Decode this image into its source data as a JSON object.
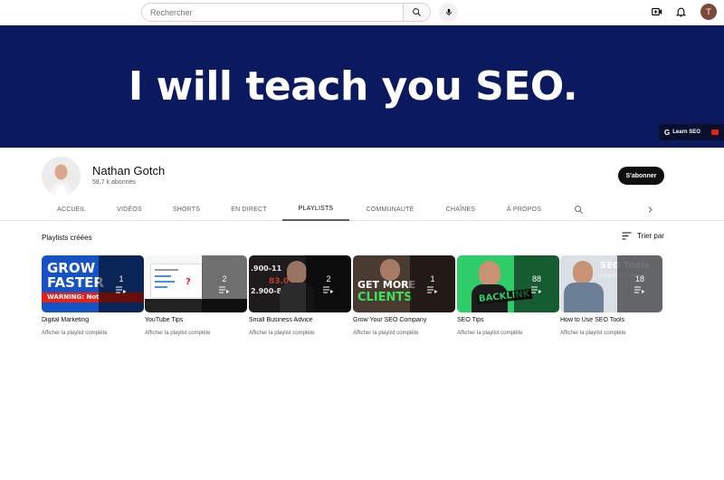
{
  "search": {
    "placeholder": "Rechercher"
  },
  "user": {
    "initial": "T"
  },
  "banner": {
    "headline": "I will teach you SEO.",
    "badge_label": "Learn SEO",
    "badge_logo": "G"
  },
  "channel": {
    "name": "Nathan Gotch",
    "subscribers": "58,7 k abonnés",
    "subscribe_label": "S'abonner"
  },
  "tabs": [
    {
      "label": "ACCUEIL"
    },
    {
      "label": "VIDÉOS"
    },
    {
      "label": "SHORTS"
    },
    {
      "label": "EN DIRECT"
    },
    {
      "label": "PLAYLISTS"
    },
    {
      "label": "COMMUNAUTÉ"
    },
    {
      "label": "CHAÎNES"
    },
    {
      "label": "À PROPOS"
    }
  ],
  "active_tab": "PLAYLISTS",
  "playlists_section": {
    "title": "Playlists créées",
    "sort_label": "Trier par"
  },
  "playlists": [
    {
      "title": "Digital Marketing",
      "count": "1",
      "link": "Afficher la playlist complète",
      "thumb_text": [
        "GROW",
        "FASTER",
        "WARNING: Not"
      ]
    },
    {
      "title": "YouTube Tips",
      "count": "2",
      "link": "Afficher la playlist complète",
      "thumb_text": []
    },
    {
      "title": "Small Business Advice",
      "count": "2",
      "link": "Afficher la playlist complète",
      "thumb_text": [
        ".900-11",
        "83.0",
        "2.900-85"
      ]
    },
    {
      "title": "Grow Your SEO Company",
      "count": "1",
      "link": "Afficher la playlist complète",
      "thumb_text": [
        "GET MORE",
        "CLIENTS"
      ]
    },
    {
      "title": "SEO Tips",
      "count": "88",
      "link": "Afficher la playlist complète",
      "thumb_text": [
        "BACKLINK"
      ]
    },
    {
      "title": "How to Use SEO Tools",
      "count": "18",
      "link": "Afficher la playlist complète",
      "thumb_text": [
        "SEO Tools",
        "(I Can't Live Without)"
      ]
    }
  ],
  "colors": {
    "banner_bg": "#0b1a5e",
    "subscribe_bg": "#0f0f0f",
    "clients_green": "#3ee05a",
    "seo_tips_green": "#2fcc6a"
  }
}
